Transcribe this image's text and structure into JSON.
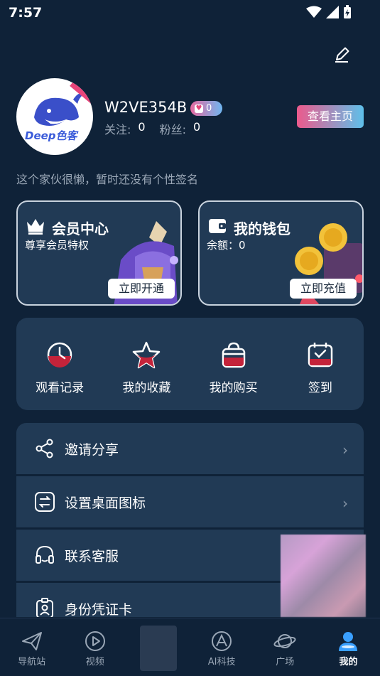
{
  "status_bar": {
    "time": "7:57"
  },
  "profile": {
    "avatar_badge": "色客",
    "avatar_logo": "Deep色客",
    "username": "W2VE354B",
    "vip_level": "0",
    "follow_label": "关注:",
    "follow_count": "0",
    "fans_label": "粉丝:",
    "fans_count": "0",
    "view_home_label": "查看主页",
    "bio": "这个家伙很懒，暂时还没有个性签名"
  },
  "cards": {
    "vip": {
      "title": "会员中心",
      "subtitle": "尊享会员特权",
      "button": "立即开通"
    },
    "wallet": {
      "title": "我的钱包",
      "subtitle": "余额：0",
      "button": "立即充值"
    }
  },
  "quick_actions": [
    {
      "label": "观看记录",
      "icon": "clock-icon"
    },
    {
      "label": "我的收藏",
      "icon": "star-icon"
    },
    {
      "label": "我的购买",
      "icon": "shopping-bag-icon"
    },
    {
      "label": "签到",
      "icon": "calendar-check-icon"
    }
  ],
  "menu": [
    {
      "label": "邀请分享",
      "icon": "share-icon",
      "arrow": "›"
    },
    {
      "label": "设置桌面图标",
      "icon": "swap-icon",
      "arrow": "›"
    },
    {
      "label": "联系客服",
      "icon": "headset-icon"
    },
    {
      "label": "身份凭证卡",
      "icon": "id-card-icon"
    }
  ],
  "tabs": [
    {
      "label": "导航站",
      "icon": "paper-plane-icon"
    },
    {
      "label": "视频",
      "icon": "play-icon"
    },
    {
      "label": "",
      "icon": "center-ad"
    },
    {
      "label": "AI科技",
      "icon": "ai-icon"
    },
    {
      "label": "广场",
      "icon": "planet-icon"
    },
    {
      "label": "我的",
      "icon": "user-icon",
      "active": true
    }
  ],
  "colors": {
    "background": "#0f2238",
    "card": "#213a55",
    "accent_pink": "#ec5a8c",
    "accent_blue": "#5ec0ea",
    "muted_text": "#9aa7b6"
  }
}
